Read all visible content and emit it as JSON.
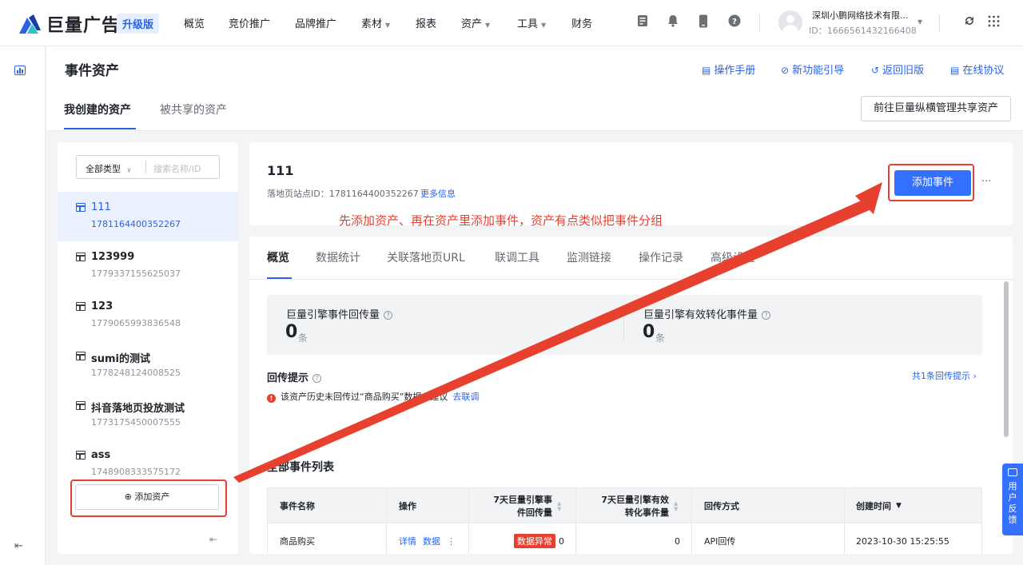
{
  "header": {
    "brand": "巨量广告",
    "upgrade_badge": "升级版",
    "nav": [
      {
        "label": "概览",
        "caret": ""
      },
      {
        "label": "竞价推广",
        "caret": ""
      },
      {
        "label": "品牌推广",
        "caret": ""
      },
      {
        "label": "素材",
        "caret": "▼"
      },
      {
        "label": "报表",
        "caret": ""
      },
      {
        "label": "资产",
        "caret": "▼"
      },
      {
        "label": "工具",
        "caret": "▼"
      },
      {
        "label": "财务",
        "caret": ""
      }
    ],
    "account_name": "深圳小鹏网络技术有限...",
    "account_id": "ID：1666561432166408",
    "icons": [
      "document-icon",
      "bell-icon",
      "phone-icon",
      "help-icon",
      "refresh-icon",
      "grid-icon"
    ]
  },
  "page": {
    "title": "事件资产",
    "header_links": [
      "操作手册",
      "新功能引导",
      "返回旧版",
      "在线协议"
    ],
    "tabs": [
      "我创建的资产",
      "被共享的资产"
    ],
    "share_button": "前往巨量纵横管理共享资产"
  },
  "asset_panel": {
    "filter_type": "全部类型",
    "search_placeholder": "搜索名称/ID",
    "assets": [
      {
        "name": "111",
        "id": "1781164400352267"
      },
      {
        "name": "123999",
        "id": "1779337155625037"
      },
      {
        "name": "123",
        "id": "1779065993836548"
      },
      {
        "name": "sumi的测试",
        "id": "1778248124008525"
      },
      {
        "name": "抖音落地页投放测试",
        "id": "1773175450007555"
      },
      {
        "name": "ass",
        "id": "1748908333575172"
      }
    ],
    "add_button": "添加资产"
  },
  "detail": {
    "title": "111",
    "site_id": "落地页站点ID：1781164400352267",
    "more_info": "更多信息",
    "add_event_button": "添加事件",
    "more_dots": "···",
    "annotation": "先添加资产、再在资产里添加事件，资产有点类似把事件分组",
    "tabs": [
      "概览",
      "数据统计",
      "关联落地页URL",
      "联调工具",
      "监测链接",
      "操作记录",
      "高级设置"
    ],
    "stats": [
      {
        "label": "巨量引擎事件回传量",
        "value": "0",
        "unit": "条"
      },
      {
        "label": "巨量引擎有效转化事件量",
        "value": "0",
        "unit": "条"
      }
    ],
    "tip_title": "回传提示",
    "tip_link": "共1条回传提示 ›",
    "tip_text": "该资产历史未回传过“商品购买”数据，建议",
    "tip_action": "去联调",
    "list_title": "全部事件列表",
    "table": {
      "headers": [
        "事件名称",
        "操作",
        "7天巨量引擎事件回传量",
        "7天巨量引擎有效转化事件量",
        "回传方式",
        "创建时间"
      ],
      "rows": [
        {
          "name": "商品购买",
          "op_detail": "详情",
          "op_data": "数据",
          "op_more": "⋮",
          "status": "数据异常",
          "count": "0",
          "valid": "0",
          "method": "API回传",
          "created": "2023-10-30 15:25:55"
        }
      ]
    }
  },
  "feedback": "用户反馈",
  "colors": {
    "accent": "#3370ff",
    "annotation": "#e8402f"
  }
}
